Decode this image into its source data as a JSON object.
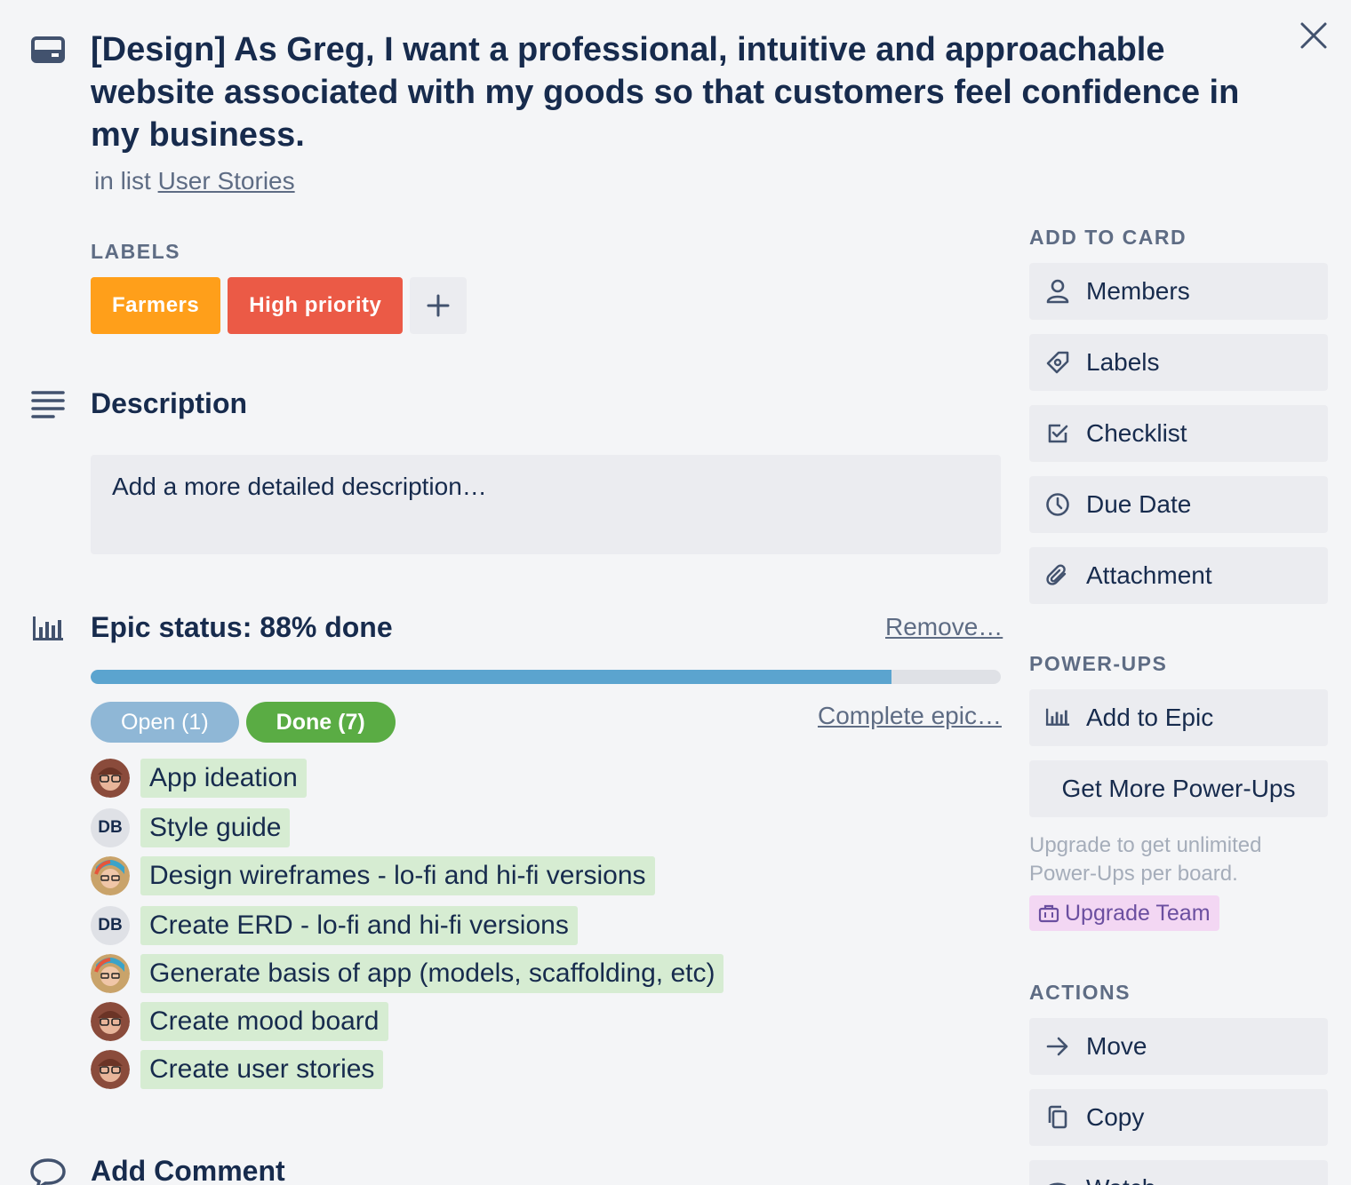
{
  "card": {
    "title": "[Design] As Greg, I want a professional, intuitive and approachable website associated with my goods so that customers feel confidence in my business.",
    "in_list_prefix": "in list",
    "list_name": "User Stories"
  },
  "labels": {
    "heading": "LABELS",
    "items": [
      {
        "text": "Farmers",
        "color": "#ff9f1a"
      },
      {
        "text": "High priority",
        "color": "#eb5a46"
      }
    ]
  },
  "description": {
    "title": "Description",
    "placeholder": "Add a more detailed description…"
  },
  "epic": {
    "title": "Epic status: 88% done",
    "progress": 0.88,
    "remove_label": "Remove…",
    "open_label": "Open (1)",
    "done_label": "Done (7)",
    "complete_label": "Complete epic…",
    "tasks": [
      {
        "avatar": "photo-a",
        "initials": "",
        "text": "App ideation"
      },
      {
        "avatar": "initials",
        "initials": "DB",
        "text": "Style guide"
      },
      {
        "avatar": "photo-b",
        "initials": "",
        "text": "Design wireframes - lo-fi and hi-fi versions"
      },
      {
        "avatar": "initials",
        "initials": "DB",
        "text": "Create ERD - lo-fi and hi-fi versions"
      },
      {
        "avatar": "photo-b",
        "initials": "",
        "text": "Generate basis of app (models, scaffolding, etc)"
      },
      {
        "avatar": "photo-a",
        "initials": "",
        "text": "Create mood board"
      },
      {
        "avatar": "photo-a",
        "initials": "",
        "text": "Create user stories"
      }
    ]
  },
  "comment": {
    "title": "Add Comment"
  },
  "sidebar": {
    "add_to_card_heading": "ADD TO CARD",
    "add_items": [
      {
        "label": "Members",
        "icon": "person-icon"
      },
      {
        "label": "Labels",
        "icon": "tag-icon"
      },
      {
        "label": "Checklist",
        "icon": "checklist-icon"
      },
      {
        "label": "Due Date",
        "icon": "clock-icon"
      },
      {
        "label": "Attachment",
        "icon": "paperclip-icon"
      }
    ],
    "powerups_heading": "POWER-UPS",
    "add_to_epic": "Add to Epic",
    "get_more": "Get More Power-Ups",
    "upgrade_note": "Upgrade to get unlimited Power-Ups per board.",
    "upgrade_team": "Upgrade Team",
    "actions_heading": "ACTIONS",
    "actions": [
      {
        "label": "Move",
        "icon": "arrow-right-icon"
      },
      {
        "label": "Copy",
        "icon": "copy-icon"
      },
      {
        "label": "Watch",
        "icon": "eye-icon"
      }
    ]
  }
}
